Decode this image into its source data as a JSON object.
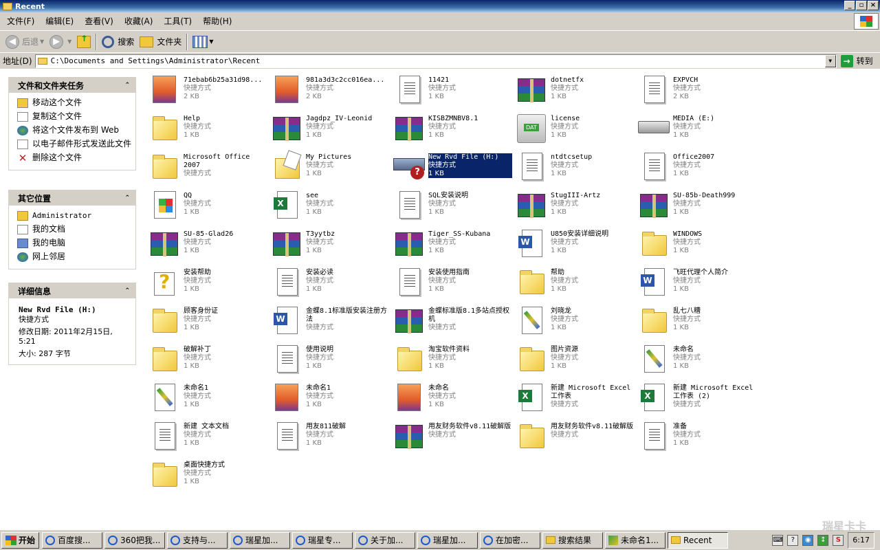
{
  "window": {
    "title": "Recent"
  },
  "menu": [
    "文件(F)",
    "编辑(E)",
    "查看(V)",
    "收藏(A)",
    "工具(T)",
    "帮助(H)"
  ],
  "toolbar": {
    "back": "后退",
    "search": "搜索",
    "folders": "文件夹"
  },
  "address": {
    "label": "地址(D)",
    "value": "C:\\Documents and Settings\\Administrator\\Recent",
    "go": "转到"
  },
  "panels": {
    "tasks": {
      "title": "文件和文件夹任务",
      "items": [
        "移动这个文件",
        "复制这个文件",
        "将这个文件发布到 Web",
        "以电子邮件形式发送此文件",
        "删除这个文件"
      ]
    },
    "places": {
      "title": "其它位置",
      "items": [
        "Administrator",
        "我的文档",
        "我的电脑",
        "网上邻居"
      ]
    },
    "details": {
      "title": "详细信息",
      "name": "New Rvd File (H:)",
      "type": "快捷方式",
      "modified": "修改日期: 2011年2月15日, 5:21",
      "size": "大小: 287 字节"
    }
  },
  "files": [
    {
      "name": "71ebab6b25a31d98...",
      "type": "快捷方式",
      "size": "2 KB",
      "icon": "image-icon"
    },
    {
      "name": "981a3d3c2cc016ea...",
      "type": "快捷方式",
      "size": "2 KB",
      "icon": "image-icon"
    },
    {
      "name": "11421",
      "type": "快捷方式",
      "size": "1 KB",
      "icon": "text-doc-icon"
    },
    {
      "name": "dotnetfx",
      "type": "快捷方式",
      "size": "1 KB",
      "icon": "rar-icon"
    },
    {
      "name": "EXPVCH",
      "type": "快捷方式",
      "size": "2 KB",
      "icon": "text-doc-icon"
    },
    {
      "name": "Help",
      "type": "快捷方式",
      "size": "1 KB",
      "icon": "folder-icon"
    },
    {
      "name": "Jagdpz_IV-Leonid",
      "type": "快捷方式",
      "size": "1 KB",
      "icon": "rar-icon"
    },
    {
      "name": "KISBZMNBV8.1",
      "type": "快捷方式",
      "size": "1 KB",
      "icon": "rar-icon"
    },
    {
      "name": "license",
      "type": "快捷方式",
      "size": "1 KB",
      "icon": "dat-icon"
    },
    {
      "name": "MEDIA (E:)",
      "type": "快捷方式",
      "size": "1 KB",
      "icon": "drive-icon"
    },
    {
      "name": "Microsoft Office 2007",
      "type": "快捷方式",
      "size": "",
      "icon": "folder-icon"
    },
    {
      "name": "My Pictures",
      "type": "快捷方式",
      "size": "1 KB",
      "icon": "pictures-folder-icon"
    },
    {
      "name": "New Rvd File (H:)",
      "type": "快捷方式",
      "size": "1 KB",
      "icon": "network-drive-icon",
      "selected": true
    },
    {
      "name": "ntdtcsetup",
      "type": "快捷方式",
      "size": "1 KB",
      "icon": "text-doc-icon"
    },
    {
      "name": "Office2007",
      "type": "快捷方式",
      "size": "1 KB",
      "icon": "text-doc-icon"
    },
    {
      "name": "QQ",
      "type": "快捷方式",
      "size": "1 KB",
      "icon": "qq-icon"
    },
    {
      "name": "see",
      "type": "快捷方式",
      "size": "1 KB",
      "icon": "excel-icon"
    },
    {
      "name": "SQL安装说明",
      "type": "快捷方式",
      "size": "1 KB",
      "icon": "text-doc-icon"
    },
    {
      "name": "StugIII-Artz",
      "type": "快捷方式",
      "size": "1 KB",
      "icon": "rar-icon"
    },
    {
      "name": "SU-85b-Death999",
      "type": "快捷方式",
      "size": "1 KB",
      "icon": "rar-icon"
    },
    {
      "name": "SU-85-Glad26",
      "type": "快捷方式",
      "size": "1 KB",
      "icon": "rar-icon"
    },
    {
      "name": "T3yytbz",
      "type": "快捷方式",
      "size": "1 KB",
      "icon": "rar-icon"
    },
    {
      "name": "Tiger_SS-Kubana",
      "type": "快捷方式",
      "size": "1 KB",
      "icon": "rar-icon"
    },
    {
      "name": "U850安装详细说明",
      "type": "快捷方式",
      "size": "1 KB",
      "icon": "word-icon"
    },
    {
      "name": "WINDOWS",
      "type": "快捷方式",
      "size": "1 KB",
      "icon": "folder-icon"
    },
    {
      "name": "安装帮助",
      "type": "快捷方式",
      "size": "1 KB",
      "icon": "help-icon"
    },
    {
      "name": "安装必读",
      "type": "快捷方式",
      "size": "1 KB",
      "icon": "text-doc-icon"
    },
    {
      "name": "安装使用指南",
      "type": "快捷方式",
      "size": "1 KB",
      "icon": "text-doc-icon"
    },
    {
      "name": "帮助",
      "type": "快捷方式",
      "size": "1 KB",
      "icon": "folder-icon"
    },
    {
      "name": "飞旺代理个人简介",
      "type": "快捷方式",
      "size": "1 KB",
      "icon": "word-icon"
    },
    {
      "name": "顾客身份证",
      "type": "快捷方式",
      "size": "1 KB",
      "icon": "folder-icon"
    },
    {
      "name": "金蝶8.1标准版安装注册方法",
      "type": "快捷方式",
      "size": "",
      "icon": "word-icon"
    },
    {
      "name": "金蝶标准版8.1多站点授权机",
      "type": "快捷方式",
      "size": "",
      "icon": "rar-icon"
    },
    {
      "name": "刘晓龙",
      "type": "快捷方式",
      "size": "1 KB",
      "icon": "paint-icon"
    },
    {
      "name": "乱七八糟",
      "type": "快捷方式",
      "size": "1 KB",
      "icon": "folder-icon"
    },
    {
      "name": "破解补丁",
      "type": "快捷方式",
      "size": "1 KB",
      "icon": "folder-icon"
    },
    {
      "name": "使用说明",
      "type": "快捷方式",
      "size": "1 KB",
      "icon": "text-doc-icon"
    },
    {
      "name": "淘宝软件资料",
      "type": "快捷方式",
      "size": "1 KB",
      "icon": "folder-icon"
    },
    {
      "name": "图片资源",
      "type": "快捷方式",
      "size": "1 KB",
      "icon": "folder-icon"
    },
    {
      "name": "未命名",
      "type": "快捷方式",
      "size": "1 KB",
      "icon": "paint-icon"
    },
    {
      "name": "未命名1",
      "type": "快捷方式",
      "size": "1 KB",
      "icon": "paint-icon"
    },
    {
      "name": "未命名1",
      "type": "快捷方式",
      "size": "1 KB",
      "icon": "image-icon"
    },
    {
      "name": "未命名",
      "type": "快捷方式",
      "size": "1 KB",
      "icon": "image-icon"
    },
    {
      "name": "新建 Microsoft Excel 工作表",
      "type": "快捷方式",
      "size": "",
      "icon": "excel-icon"
    },
    {
      "name": "新建 Microsoft Excel 工作表 (2)",
      "type": "快捷方式",
      "size": "",
      "icon": "excel-icon"
    },
    {
      "name": "新建 文本文档",
      "type": "快捷方式",
      "size": "1 KB",
      "icon": "text-doc-icon"
    },
    {
      "name": "用友811破解",
      "type": "快捷方式",
      "size": "1 KB",
      "icon": "text-doc-icon"
    },
    {
      "name": "用友财务软件v8.11破解版",
      "type": "快捷方式",
      "size": "",
      "icon": "rar-icon"
    },
    {
      "name": "用友财务软件v8.11破解版",
      "type": "快捷方式",
      "size": "",
      "icon": "folder-icon"
    },
    {
      "name": "准备",
      "type": "快捷方式",
      "size": "1 KB",
      "icon": "text-doc-icon"
    },
    {
      "name": "桌面快捷方式",
      "type": "快捷方式",
      "size": "1 KB",
      "icon": "folder-icon"
    }
  ],
  "taskbar": {
    "start": "开始",
    "items": [
      {
        "label": "百度搜...",
        "icon": "ie"
      },
      {
        "label": "360把我...",
        "icon": "ie"
      },
      {
        "label": "支持与...",
        "icon": "ie"
      },
      {
        "label": "瑞星加...",
        "icon": "ie"
      },
      {
        "label": "瑞星专...",
        "icon": "ie"
      },
      {
        "label": "关于加...",
        "icon": "ie"
      },
      {
        "label": "瑞星加...",
        "icon": "ie"
      },
      {
        "label": "在加密...",
        "icon": "ie"
      },
      {
        "label": "搜索结果",
        "icon": "fo"
      },
      {
        "label": "未命名1...",
        "icon": "pa"
      },
      {
        "label": "Recent",
        "icon": "fo",
        "active": true
      }
    ],
    "clock": "6:17"
  },
  "watermark": "瑞星卡卡"
}
